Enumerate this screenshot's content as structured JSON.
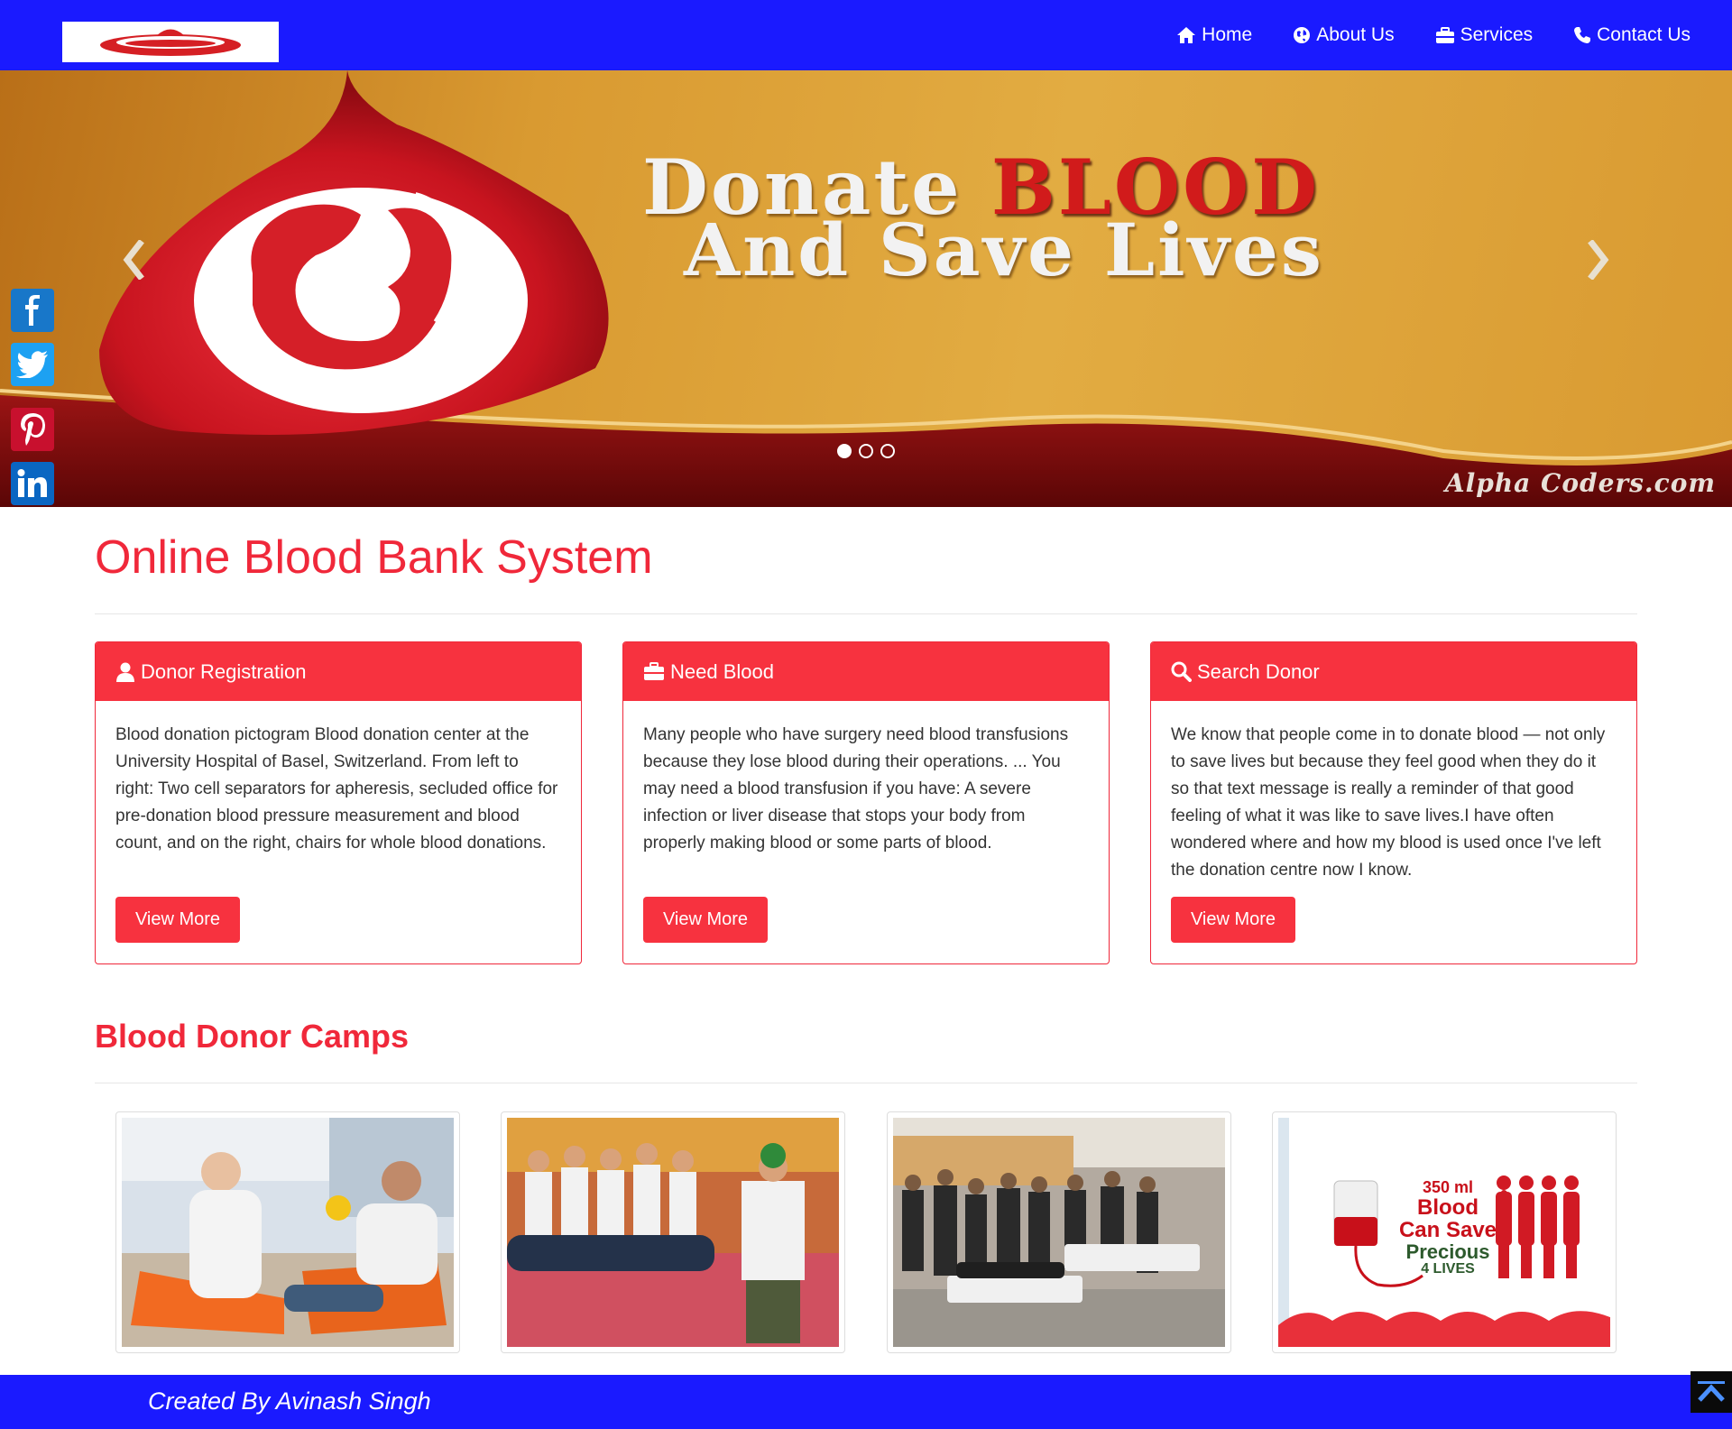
{
  "nav": {
    "links": [
      {
        "label": "Home",
        "icon": "home-icon"
      },
      {
        "label": "About Us",
        "icon": "globe-icon"
      },
      {
        "label": "Services",
        "icon": "briefcase-icon"
      },
      {
        "label": "Contact Us",
        "icon": "phone-icon"
      }
    ]
  },
  "hero": {
    "line1_white": "Donate",
    "line1_red": "BLOOD",
    "line2": "And Save Lives",
    "watermark": "Alpha Coders.com",
    "active_slide": 1,
    "slide_count": 3
  },
  "social": [
    "facebook-icon",
    "twitter-icon",
    "pinterest-icon",
    "linkedin-icon"
  ],
  "page_title": "Online Blood Bank System",
  "panels": [
    {
      "title": "Donor Registration",
      "icon": "user-icon",
      "body": "Blood donation pictogram Blood donation center at the University Hospital of Basel, Switzerland. From left to right: Two cell separators for apheresis, secluded office for pre-donation blood pressure measurement and blood count, and on the right, chairs for whole blood donations.",
      "button": "View More"
    },
    {
      "title": "Need Blood",
      "icon": "briefcase-icon",
      "body": "Many people who have surgery need blood transfusions because they lose blood during their operations. ... You may need a blood transfusion if you have: A severe infection or liver disease that stops your body from properly making blood or some parts of blood.",
      "button": "View More"
    },
    {
      "title": "Search Donor",
      "icon": "search-icon",
      "body": "We know that people come in to donate blood — not only to save lives but because they feel good when they do it so that text message is really a reminder of that good feeling of what it was like to save lives.I have often wondered where and how my blood is used once I've left the donation centre now I know.",
      "button": "View More"
    }
  ],
  "camps_title": "Blood Donor Camps",
  "camp4": {
    "line1": "350 ml",
    "line2": "Blood",
    "line3": "Can Save",
    "line4": "Precious",
    "line5": "4 LIVES"
  },
  "footer": {
    "text": "Created By Avinash Singh"
  },
  "colors": {
    "nav": "#1a1aff",
    "accent": "#f7323f",
    "footer": "#1a1aff"
  }
}
